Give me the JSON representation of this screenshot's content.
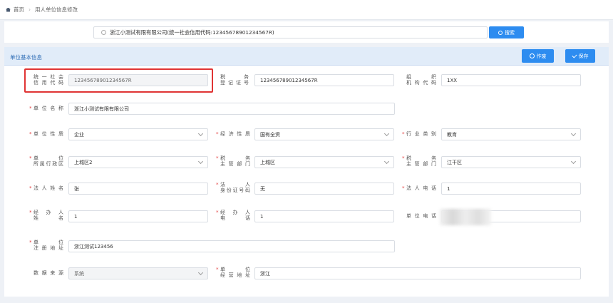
{
  "breadcrumb": {
    "home": "首页",
    "current": "用人单位信息修改"
  },
  "search": {
    "value": "浙江小测试有限有限公司(统一社会信用代码:12345678901234567R)",
    "button": "搜索"
  },
  "panel": {
    "title": "单位基本信息",
    "cancel": "作废",
    "save": "保存"
  },
  "form": {
    "credit_code": {
      "label": "统一社会信用代码",
      "value": "12345678901234567R"
    },
    "tax_reg": {
      "label": "税务登记证号",
      "value": "12345678901234567R"
    },
    "org_code": {
      "label": "组织机构代码",
      "value": "1XX"
    },
    "unit_name": {
      "label": "单位名称",
      "value": "浙江小测试有限有限公司"
    },
    "unit_nature": {
      "label": "单位性质",
      "value": "企业"
    },
    "econ_nature": {
      "label": "经济性质",
      "value": "国有全资"
    },
    "industry": {
      "label": "行业类别",
      "value": "教育"
    },
    "admin_region": {
      "label": "单位所属行政区",
      "value": "上城区2"
    },
    "labor_dept": {
      "label": "税务主管部门",
      "value": "上城区"
    },
    "tax_dept": {
      "label": "税务主管部门",
      "value": "江干区"
    },
    "legal_name": {
      "label": "法人姓名",
      "value": "张"
    },
    "legal_id": {
      "label": "法人身份证号码",
      "value": "无"
    },
    "legal_phone": {
      "label": "法人电话",
      "value": "1"
    },
    "agent_name": {
      "label": "经办人姓名",
      "value": "1"
    },
    "agent_phone": {
      "label": "经办人电话",
      "value": "1"
    },
    "unit_phone": {
      "label": "单位电话",
      "value": ""
    },
    "reg_address": {
      "label": "单位注册地址",
      "value": "浙江测试123456"
    },
    "data_source": {
      "label": "数据来源",
      "value": "系统"
    },
    "biz_address": {
      "label": "单位经营地址",
      "value": "浙江"
    }
  }
}
